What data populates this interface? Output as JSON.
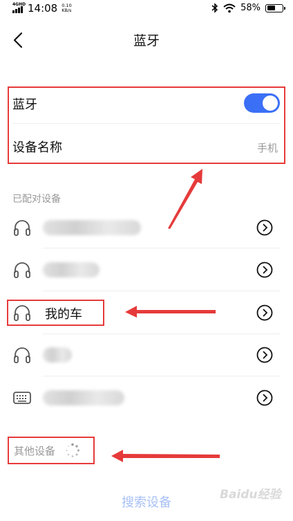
{
  "status_bar": {
    "network": "4GHD",
    "time": "14:08",
    "speed_value": "0.10",
    "speed_unit": "KB/s",
    "battery_percent": "58%",
    "battery_level": 0.58
  },
  "header": {
    "title": "蓝牙"
  },
  "settings": {
    "bluetooth_label": "蓝牙",
    "bluetooth_on": true,
    "device_name_label": "设备名称",
    "device_name_value": "手机"
  },
  "paired": {
    "section_title": "已配对设备",
    "devices": [
      {
        "icon": "headphones-icon",
        "name": ""
      },
      {
        "icon": "headphones-icon",
        "name": ""
      },
      {
        "icon": "headphones-icon",
        "name": "我的车"
      },
      {
        "icon": "headphones-icon",
        "name": ""
      },
      {
        "icon": "keyboard-icon",
        "name": ""
      }
    ]
  },
  "other": {
    "section_title": "其他设备"
  },
  "actions": {
    "search_label": "搜索设备"
  },
  "colors": {
    "accent": "#3b6ff5",
    "annotation": "#e63a3a"
  },
  "watermark": "Baidu经验"
}
